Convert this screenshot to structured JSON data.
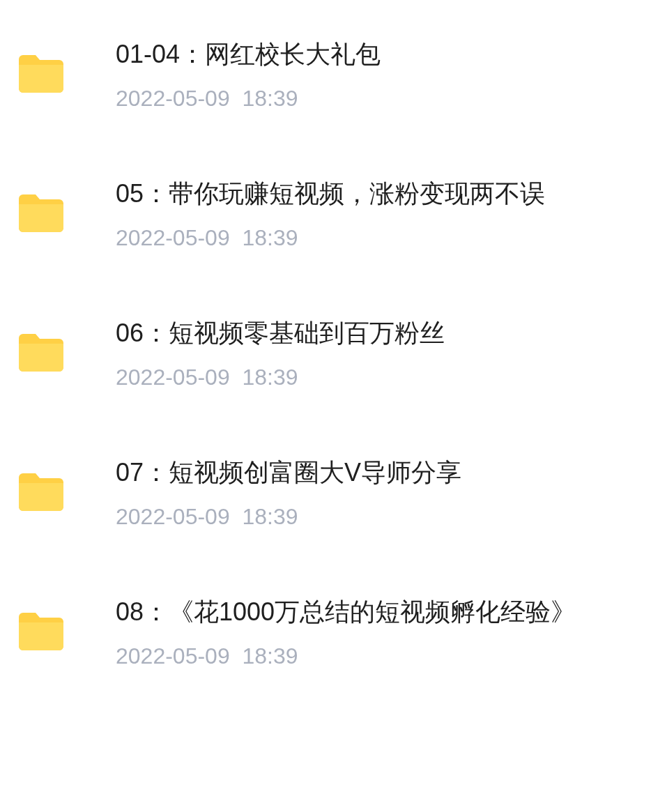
{
  "files": [
    {
      "name": "01-04：网红校长大礼包",
      "date": "2022-05-09  18:39"
    },
    {
      "name": "05：带你玩赚短视频，涨粉变现两不误",
      "date": "2022-05-09  18:39"
    },
    {
      "name": "06：短视频零基础到百万粉丝",
      "date": "2022-05-09  18:39"
    },
    {
      "name": "07：短视频创富圈大V导师分享",
      "date": "2022-05-09  18:39"
    },
    {
      "name": "08：《花1000万总结的短视频孵化经验》",
      "date": "2022-05-09  18:39"
    }
  ]
}
